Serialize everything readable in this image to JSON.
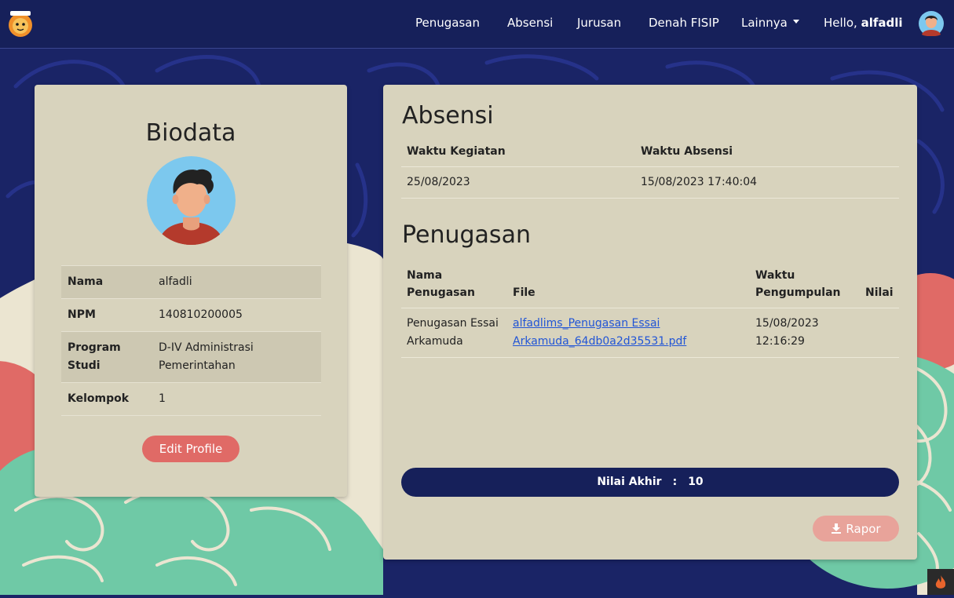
{
  "nav": {
    "items": [
      "Penugasan",
      "Absensi",
      "Jurusan",
      "Denah FISIP",
      "Lainnya"
    ],
    "hello": "Hello,",
    "username": "alfadli"
  },
  "biodata": {
    "title": "Biodata",
    "rows": [
      {
        "label": "Nama",
        "value": "alfadli"
      },
      {
        "label": "NPM",
        "value": "140810200005"
      },
      {
        "label": "Program Studi",
        "value": "D-IV Administrasi Pemerintahan"
      },
      {
        "label": "Kelompok",
        "value": "1"
      }
    ],
    "edit_label": "Edit Profile"
  },
  "absensi": {
    "title": "Absensi",
    "headers": [
      "Waktu Kegiatan",
      "Waktu Absensi"
    ],
    "rows": [
      [
        "25/08/2023",
        "15/08/2023 17:40:04"
      ]
    ]
  },
  "penugasan": {
    "title": "Penugasan",
    "headers": [
      "Nama Penugasan",
      "File",
      "Waktu Pengumpulan",
      "Nilai"
    ],
    "rows": [
      {
        "nama": "Penugasan Essai Arkamuda",
        "file": "alfadlims_Penugasan Essai Arkamuda_64db0a2d35531.pdf",
        "waktu": "15/08/2023 12:16:29",
        "nilai": ""
      }
    ]
  },
  "nilai_akhir": {
    "label": "Nilai Akhir",
    "separator": ":",
    "value": "10"
  },
  "rapor_label": "Rapor",
  "colors": {
    "navy": "#16205a",
    "card": "#d8d3bd",
    "coral": "#e06a66",
    "teal": "#6fc9a6",
    "cream": "#ebe5d1",
    "link": "#2155d6"
  }
}
